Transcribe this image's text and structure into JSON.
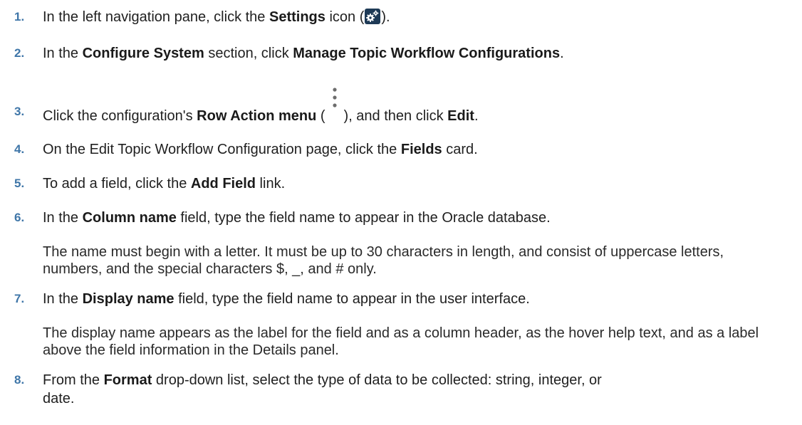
{
  "steps": [
    {
      "num": "1.",
      "a": "In the left navigation pane, click the ",
      "b1": "Settings",
      "c": " icon (",
      "d": ")."
    },
    {
      "num": "2.",
      "a": "In the ",
      "b1": "Configure System",
      "c": " section, click ",
      "b2": "Manage Topic Workflow Configurations",
      "d": "."
    },
    {
      "num": "3.",
      "a": "Click the configuration's ",
      "b1": "Row Action menu",
      "c": " (",
      "d": "), and then click ",
      "b2": "Edit",
      "e": "."
    },
    {
      "num": "4.",
      "a": "On the Edit Topic Workflow Configuration page, click the ",
      "b1": "Fields",
      "c": " card."
    },
    {
      "num": "5.",
      "a": "To add a field, click the ",
      "b1": "Add Field",
      "c": " link."
    },
    {
      "num": "6.",
      "a": "In the ",
      "b1": "Column name",
      "c": " field, type the field name to appear in the Oracle database.",
      "note": "The name must begin with a letter. It must be up to 30 characters in length, and consist of uppercase letters, numbers, and the special characters $, _, and # only."
    },
    {
      "num": "7.",
      "a": "In the ",
      "b1": "Display name",
      "c": " field, type the field name to appear in the user interface.",
      "note": "The display name appears as the label for the field and as a column header, as the hover help text, and as a label above the field information in the Details panel."
    },
    {
      "num": "8.",
      "a": "From the ",
      "b1": "Format",
      "c": " drop-down list, select the type of data to be collected: string, integer, or",
      "c2": "date."
    }
  ]
}
